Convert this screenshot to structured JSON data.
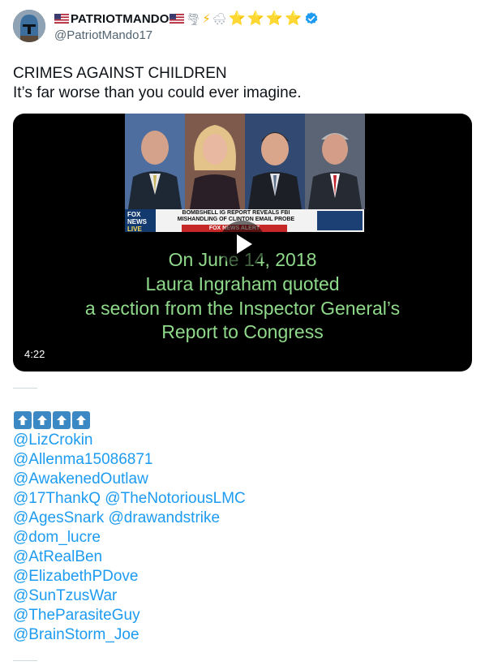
{
  "author": {
    "display_name": "PATRIOTMANDO",
    "handle": "@PatriotMando17",
    "name_emoji": [
      "🌪",
      "⚡",
      "🌨",
      "⭐",
      "⭐",
      "⭐",
      "⭐"
    ],
    "verified": true,
    "avatar_icon": "mandalorian-helmet-avatar"
  },
  "tweet": {
    "lines": [
      "CRIMES AGAINST CHILDREN",
      "It’s far worse than you could ever imagine."
    ]
  },
  "video": {
    "duration": "4:22",
    "caption_lines": [
      "On  June  14,  2018",
      "Laura Ingraham quoted",
      "a section from the Inspector General’s",
      "Report to Congress"
    ],
    "chyron": {
      "channel": "FOX NEWS",
      "live": "LIVE",
      "headline_1": "BOMBSHELL IG REPORT REVEALS FBI",
      "headline_2": "MISHANDLING OF CLINTON EMAIL PROBE",
      "alert": "FOX NEWS ALERT"
    }
  },
  "arrow_emoji_count": 4,
  "mention_lines": [
    [
      "@LizCrokin"
    ],
    [
      "@Allenma15086871"
    ],
    [
      "@AwakenedOutlaw"
    ],
    [
      "@17ThankQ",
      "@TheNotoriousLMC"
    ],
    [
      "@AgesSnark",
      "@drawandstrike"
    ],
    [
      "@dom_lucre"
    ],
    [
      "@AtRealBen"
    ],
    [
      "@ElizabethPDove"
    ],
    [
      "@SunTzusWar"
    ],
    [
      "@TheParasiteGuy"
    ],
    [
      "@BrainStorm_Joe"
    ]
  ],
  "colors": {
    "link": "#1d9bf0",
    "verified": "#1d9bf0",
    "caption": "#8fd98a",
    "arrow_box": "#3b88c3"
  }
}
